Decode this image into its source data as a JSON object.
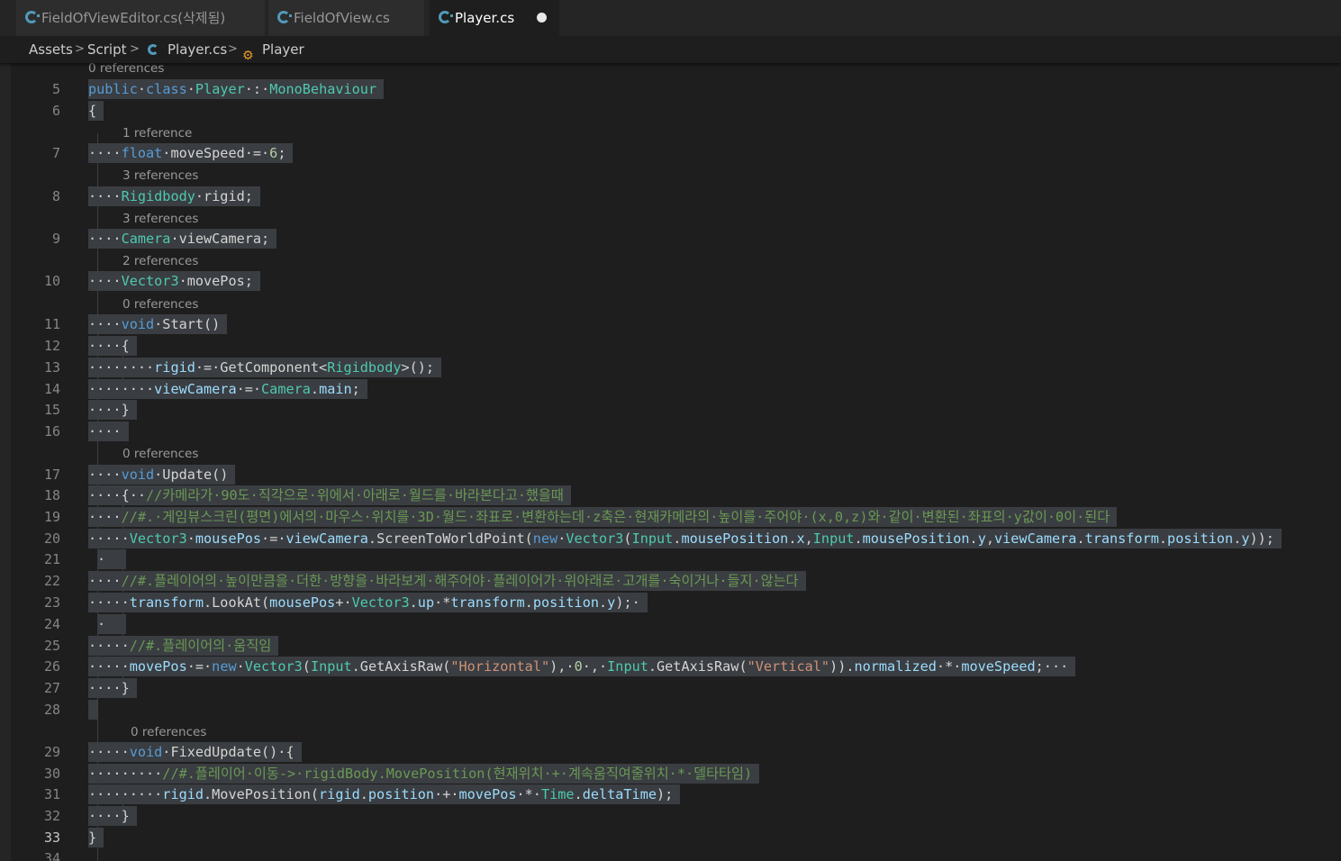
{
  "tabs": [
    {
      "label": "FieldOfViewEditor.cs(삭제됨)",
      "icon": "csharp-file-icon",
      "active": false
    },
    {
      "label": "FieldOfView.cs",
      "icon": "csharp-file-icon",
      "active": false
    },
    {
      "label": "Player.cs",
      "icon": "csharp-file-icon",
      "active": true,
      "modified": true
    }
  ],
  "breadcrumb": {
    "folder1": "Assets",
    "folder2": "Script",
    "file": "Player.cs",
    "symbol": "Player",
    "separator": ">"
  },
  "editor": {
    "current_line": 33,
    "colors": {
      "background": "#1e1e1e",
      "selection": "#3a3d41",
      "keyword": "#569cd6",
      "type": "#4ec9b0",
      "identifier": "#9cdcfe",
      "number": "#b5cea8",
      "string": "#ce9178",
      "comment": "#6a9955"
    },
    "codelens": {
      "l5": "0 references",
      "l7": "1 reference",
      "l8": "3 references",
      "l9": "3 references",
      "l10": "2 references",
      "l11": "0 references",
      "l17": "0 references",
      "l29": "0 references"
    },
    "lines": [
      {
        "n": "5",
        "tokens": [
          {
            "c": "kw",
            "t": "public"
          },
          {
            "c": "pl",
            "t": "·"
          },
          {
            "c": "kw",
            "t": "class"
          },
          {
            "c": "pl",
            "t": "·"
          },
          {
            "c": "ty",
            "t": "Player"
          },
          {
            "c": "pl",
            "t": "·:·"
          },
          {
            "c": "ty",
            "t": "MonoBehaviour"
          }
        ]
      },
      {
        "n": "6",
        "tokens": [
          {
            "c": "pl",
            "t": "{"
          }
        ]
      },
      {
        "n": "7",
        "tokens": [
          {
            "c": "pl",
            "t": "····"
          },
          {
            "c": "kw",
            "t": "float"
          },
          {
            "c": "pl",
            "t": "·moveSpeed·=·"
          },
          {
            "c": "nm",
            "t": "6"
          },
          {
            "c": "pl",
            "t": ";"
          }
        ]
      },
      {
        "n": "8",
        "tokens": [
          {
            "c": "pl",
            "t": "····"
          },
          {
            "c": "ty",
            "t": "Rigidbody"
          },
          {
            "c": "pl",
            "t": "·rigid;"
          }
        ]
      },
      {
        "n": "9",
        "tokens": [
          {
            "c": "pl",
            "t": "····"
          },
          {
            "c": "ty",
            "t": "Camera"
          },
          {
            "c": "pl",
            "t": "·viewCamera;"
          }
        ]
      },
      {
        "n": "10",
        "tokens": [
          {
            "c": "pl",
            "t": "····"
          },
          {
            "c": "ty",
            "t": "Vector3"
          },
          {
            "c": "pl",
            "t": "·movePos;"
          }
        ]
      },
      {
        "n": "11",
        "tokens": [
          {
            "c": "pl",
            "t": "····"
          },
          {
            "c": "kw",
            "t": "void"
          },
          {
            "c": "pl",
            "t": "·Start()"
          }
        ]
      },
      {
        "n": "12",
        "tokens": [
          {
            "c": "pl",
            "t": "····{"
          }
        ]
      },
      {
        "n": "13",
        "tokens": [
          {
            "c": "pl",
            "t": "········"
          },
          {
            "c": "id",
            "t": "rigid"
          },
          {
            "c": "pl",
            "t": "·=·GetComponent<"
          },
          {
            "c": "ty",
            "t": "Rigidbody"
          },
          {
            "c": "pl",
            "t": ">();"
          }
        ]
      },
      {
        "n": "14",
        "tokens": [
          {
            "c": "pl",
            "t": "········"
          },
          {
            "c": "id",
            "t": "viewCamera"
          },
          {
            "c": "pl",
            "t": "·=·"
          },
          {
            "c": "ty",
            "t": "Camera"
          },
          {
            "c": "pl",
            "t": "."
          },
          {
            "c": "id",
            "t": "main"
          },
          {
            "c": "pl",
            "t": ";"
          }
        ]
      },
      {
        "n": "15",
        "tokens": [
          {
            "c": "pl",
            "t": "····}"
          }
        ]
      },
      {
        "n": "16",
        "tokens": [
          {
            "c": "pl",
            "t": "····"
          }
        ]
      },
      {
        "n": "17",
        "tokens": [
          {
            "c": "pl",
            "t": "····"
          },
          {
            "c": "kw",
            "t": "void"
          },
          {
            "c": "pl",
            "t": "·Update()"
          }
        ]
      },
      {
        "n": "18",
        "tokens": [
          {
            "c": "pl",
            "t": "····{··"
          },
          {
            "c": "cm",
            "t": "//카메라가·90도·직각으로·위에서·아래로·월드를·바라본다고·했을때"
          }
        ]
      },
      {
        "n": "19",
        "tokens": [
          {
            "c": "pl",
            "t": "····"
          },
          {
            "c": "cm",
            "t": "//#.·게임뷰스크린(평면)에서의·마우스·위치를·3D·월드·좌표로·변환하는데·z축은·현재카메라의·높이를·주어야·(x,0,z)와·같이·변환된·좌표의·y값이·0이·된다"
          }
        ]
      },
      {
        "n": "20",
        "tokens": [
          {
            "c": "pl",
            "t": "·····"
          },
          {
            "c": "ty",
            "t": "Vector3"
          },
          {
            "c": "pl",
            "t": "·"
          },
          {
            "c": "id",
            "t": "mousePos"
          },
          {
            "c": "pl",
            "t": "·=·"
          },
          {
            "c": "id",
            "t": "viewCamera"
          },
          {
            "c": "pl",
            "t": ".ScreenToWorldPoint("
          },
          {
            "c": "kw",
            "t": "new"
          },
          {
            "c": "pl",
            "t": "·"
          },
          {
            "c": "ty",
            "t": "Vector3"
          },
          {
            "c": "pl",
            "t": "("
          },
          {
            "c": "ty",
            "t": "Input"
          },
          {
            "c": "pl",
            "t": "."
          },
          {
            "c": "id",
            "t": "mousePosition"
          },
          {
            "c": "pl",
            "t": "."
          },
          {
            "c": "id",
            "t": "x"
          },
          {
            "c": "pl",
            "t": ","
          },
          {
            "c": "ty",
            "t": "Input"
          },
          {
            "c": "pl",
            "t": "."
          },
          {
            "c": "id",
            "t": "mousePosition"
          },
          {
            "c": "pl",
            "t": "."
          },
          {
            "c": "id",
            "t": "y"
          },
          {
            "c": "pl",
            "t": ","
          },
          {
            "c": "id",
            "t": "viewCamera"
          },
          {
            "c": "pl",
            "t": "."
          },
          {
            "c": "id",
            "t": "transform"
          },
          {
            "c": "pl",
            "t": "."
          },
          {
            "c": "id",
            "t": "position"
          },
          {
            "c": "pl",
            "t": "."
          },
          {
            "c": "id",
            "t": "y"
          },
          {
            "c": "pl",
            "t": "));"
          }
        ]
      },
      {
        "n": "21",
        "tokens": [
          {
            "c": "pl",
            "t": "·"
          }
        ]
      },
      {
        "n": "22",
        "tokens": [
          {
            "c": "pl",
            "t": "····"
          },
          {
            "c": "cm",
            "t": "//#.플레이어의·높이만큼을·더한·방향을·바라보게·해주어야·플레이어가·위아래로·고개를·숙이거나·들지·않는다"
          }
        ]
      },
      {
        "n": "23",
        "tokens": [
          {
            "c": "pl",
            "t": "·····"
          },
          {
            "c": "id",
            "t": "transform"
          },
          {
            "c": "pl",
            "t": ".LookAt("
          },
          {
            "c": "id",
            "t": "mousePos"
          },
          {
            "c": "pl",
            "t": "+·"
          },
          {
            "c": "ty",
            "t": "Vector3"
          },
          {
            "c": "pl",
            "t": "."
          },
          {
            "c": "id",
            "t": "up"
          },
          {
            "c": "pl",
            "t": "·*"
          },
          {
            "c": "id",
            "t": "transform"
          },
          {
            "c": "pl",
            "t": "."
          },
          {
            "c": "id",
            "t": "position"
          },
          {
            "c": "pl",
            "t": "."
          },
          {
            "c": "id",
            "t": "y"
          },
          {
            "c": "pl",
            "t": ");·"
          }
        ]
      },
      {
        "n": "24",
        "tokens": [
          {
            "c": "pl",
            "t": "·"
          }
        ]
      },
      {
        "n": "25",
        "tokens": [
          {
            "c": "pl",
            "t": "·····"
          },
          {
            "c": "cm",
            "t": "//#.플레이어의·움직임"
          }
        ]
      },
      {
        "n": "26",
        "tokens": [
          {
            "c": "pl",
            "t": "·····"
          },
          {
            "c": "id",
            "t": "movePos"
          },
          {
            "c": "pl",
            "t": "·=·"
          },
          {
            "c": "kw",
            "t": "new"
          },
          {
            "c": "pl",
            "t": "·"
          },
          {
            "c": "ty",
            "t": "Vector3"
          },
          {
            "c": "pl",
            "t": "("
          },
          {
            "c": "ty",
            "t": "Input"
          },
          {
            "c": "pl",
            "t": ".GetAxisRaw("
          },
          {
            "c": "st",
            "t": "\"Horizontal\""
          },
          {
            "c": "pl",
            "t": "),·"
          },
          {
            "c": "nm",
            "t": "0"
          },
          {
            "c": "pl",
            "t": "·,·"
          },
          {
            "c": "ty",
            "t": "Input"
          },
          {
            "c": "pl",
            "t": ".GetAxisRaw("
          },
          {
            "c": "st",
            "t": "\"Vertical\""
          },
          {
            "c": "pl",
            "t": "))."
          },
          {
            "c": "id",
            "t": "normalized"
          },
          {
            "c": "pl",
            "t": "·*·"
          },
          {
            "c": "id",
            "t": "moveSpeed"
          },
          {
            "c": "pl",
            "t": ";···"
          }
        ]
      },
      {
        "n": "27",
        "tokens": [
          {
            "c": "pl",
            "t": "····}"
          }
        ]
      },
      {
        "n": "28",
        "tokens": [
          {
            "c": "pl",
            "t": ""
          }
        ]
      },
      {
        "n": "29",
        "tokens": [
          {
            "c": "pl",
            "t": "·····"
          },
          {
            "c": "kw",
            "t": "void"
          },
          {
            "c": "pl",
            "t": "·FixedUpdate()·{"
          }
        ]
      },
      {
        "n": "30",
        "tokens": [
          {
            "c": "pl",
            "t": "·········"
          },
          {
            "c": "cm",
            "t": "//#.플레이어·이동->·rigidBody.MovePosition(현재위치·+·계속움직여줄위치·*·델타타임)"
          }
        ]
      },
      {
        "n": "31",
        "tokens": [
          {
            "c": "pl",
            "t": "·········"
          },
          {
            "c": "id",
            "t": "rigid"
          },
          {
            "c": "pl",
            "t": ".MovePosition("
          },
          {
            "c": "id",
            "t": "rigid"
          },
          {
            "c": "pl",
            "t": "."
          },
          {
            "c": "id",
            "t": "position"
          },
          {
            "c": "pl",
            "t": "·+·"
          },
          {
            "c": "id",
            "t": "movePos"
          },
          {
            "c": "pl",
            "t": "·*·"
          },
          {
            "c": "ty",
            "t": "Time"
          },
          {
            "c": "pl",
            "t": "."
          },
          {
            "c": "id",
            "t": "deltaTime"
          },
          {
            "c": "pl",
            "t": ");"
          }
        ]
      },
      {
        "n": "32",
        "tokens": [
          {
            "c": "pl",
            "t": "····}"
          }
        ]
      },
      {
        "n": "33",
        "tokens": [
          {
            "c": "pl",
            "t": "}"
          }
        ]
      },
      {
        "n": "34",
        "tokens": []
      }
    ]
  }
}
